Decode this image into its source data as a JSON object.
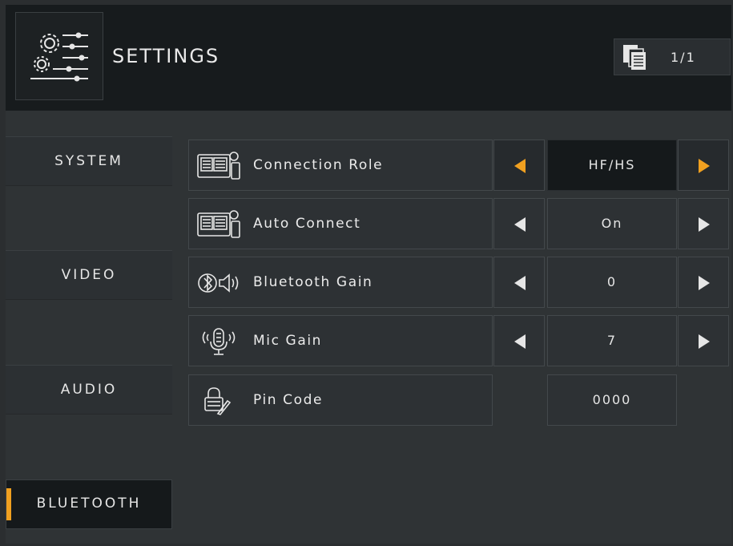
{
  "header": {
    "title": "SETTINGS",
    "settings_icon": "gears-sliders-icon",
    "page_icon": "pages-icon",
    "page_indicator": "1/1"
  },
  "sidebar": {
    "items": [
      {
        "label": "SYSTEM",
        "active": false
      },
      {
        "label": "VIDEO",
        "active": false
      },
      {
        "label": "AUDIO",
        "active": false
      },
      {
        "label": "BLUETOOTH",
        "active": true
      }
    ]
  },
  "rows": [
    {
      "label": "Connection Role",
      "value": "HF/HS",
      "icon": "head-unit-phone-icon",
      "selected": true
    },
    {
      "label": "Auto Connect",
      "value": "On",
      "icon": "head-unit-phone-icon",
      "selected": false
    },
    {
      "label": "Bluetooth Gain",
      "value": "0",
      "icon": "bluetooth-speaker-icon",
      "selected": false
    },
    {
      "label": "Mic Gain",
      "value": "7",
      "icon": "microphone-icon",
      "selected": false
    },
    {
      "label": "Pin Code",
      "value": "0000",
      "icon": "lock-pen-icon",
      "selected": false
    }
  ],
  "colors": {
    "accent": "#f0a020",
    "header_bg": "#171b1d",
    "panel_bg": "#2f3335"
  }
}
